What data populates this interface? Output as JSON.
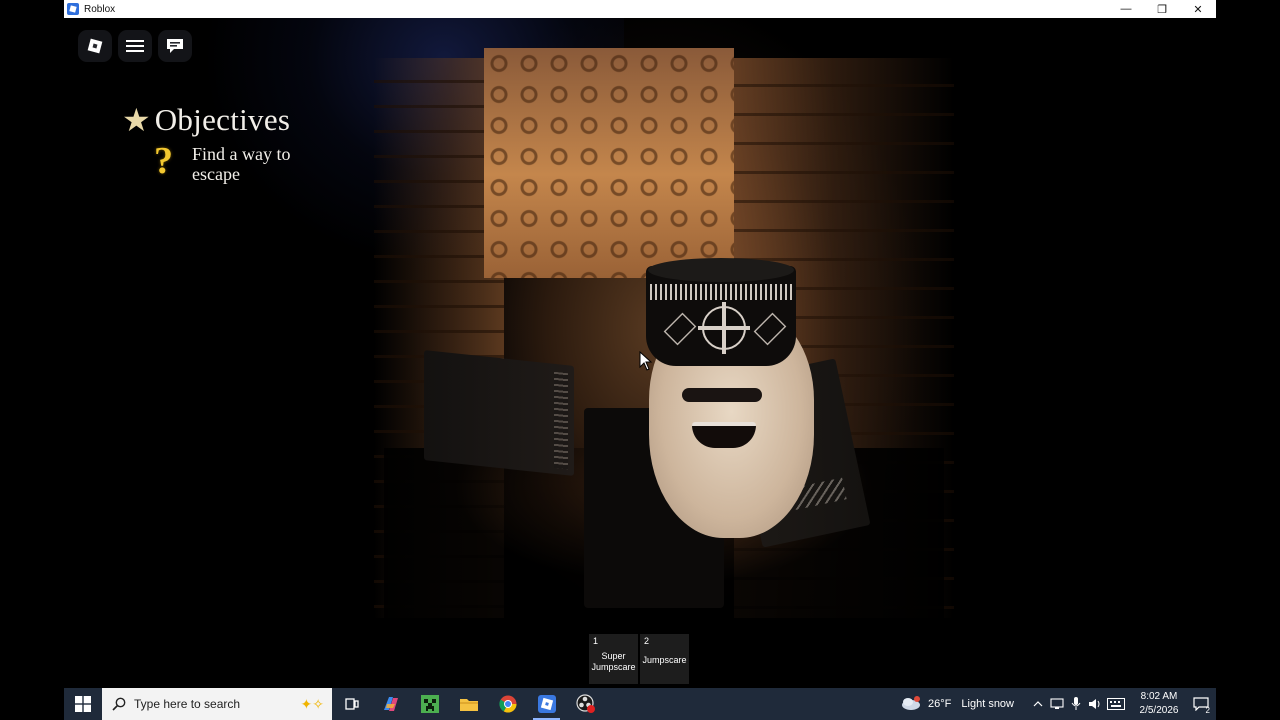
{
  "window": {
    "title": "Roblox",
    "minimize_glyph": "—",
    "restore_glyph": "❐",
    "close_glyph": "✕"
  },
  "hud": {
    "buttons": [
      {
        "icon": "roblox-logo-icon"
      },
      {
        "icon": "hamburger-menu-icon"
      },
      {
        "icon": "chat-icon"
      }
    ]
  },
  "objectives": {
    "title": "Objectives",
    "star_glyph": "★",
    "items": [
      {
        "icon": "question-mark-icon",
        "glyph": "?",
        "text": "Find a way to escape"
      }
    ]
  },
  "hotbar": {
    "slots": [
      {
        "number": "1",
        "label": "Super Jumpscare"
      },
      {
        "number": "2",
        "label": "Jumpscare"
      }
    ]
  },
  "taskbar": {
    "search_placeholder": "Type here to search",
    "apps": [
      {
        "icon": "task-view-icon"
      },
      {
        "icon": "copilot-icon"
      },
      {
        "icon": "minecraft-icon"
      },
      {
        "icon": "file-explorer-icon"
      },
      {
        "icon": "chrome-icon"
      },
      {
        "icon": "roblox-icon",
        "active": true
      },
      {
        "icon": "obs-icon"
      }
    ],
    "weather": {
      "temp": "26°F",
      "condition": "Light snow",
      "alert_count": "3"
    },
    "clock": {
      "time": "8:02 AM",
      "date": "2/5/2026"
    },
    "notification_count": "2"
  },
  "colors": {
    "taskbar_bg": "#1f2a3a",
    "objective_question": "#f3c830",
    "titlebar_bg": "#ffffff"
  }
}
